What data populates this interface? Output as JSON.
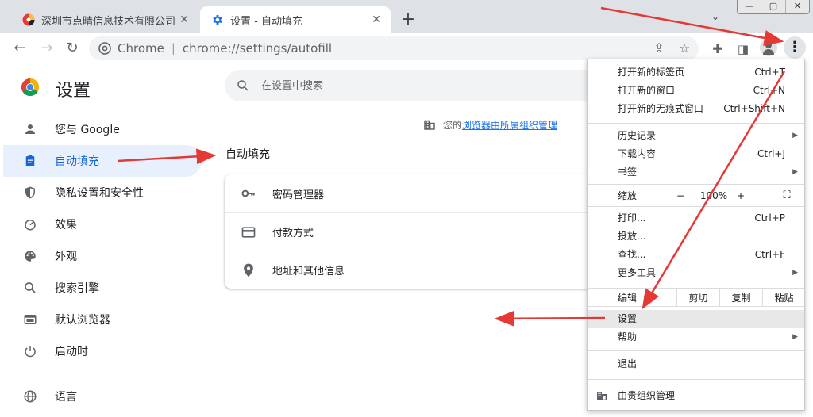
{
  "tabs": [
    {
      "title": "深圳市点晴信息技术有限公司点晴",
      "active": false,
      "favicon": "site-favicon"
    },
    {
      "title": "设置 - 自动填充",
      "active": true,
      "favicon": "gear-icon"
    }
  ],
  "new_tab": "+",
  "window_controls": {
    "minimize": "—",
    "maximize": "▢",
    "close": "✕"
  },
  "address": {
    "scheme": "Chrome",
    "separator": "|",
    "url": "chrome://settings/autofill"
  },
  "settings": {
    "title": "设置",
    "search_placeholder": "在设置中搜索",
    "nav": [
      {
        "label": "您与 Google",
        "icon": "person-icon",
        "active": false
      },
      {
        "label": "自动填充",
        "icon": "clipboard-icon",
        "active": true
      },
      {
        "label": "隐私设置和安全性",
        "icon": "shield-icon",
        "active": false
      },
      {
        "label": "效果",
        "icon": "speedometer-icon",
        "active": false
      },
      {
        "label": "外观",
        "icon": "palette-icon",
        "active": false
      },
      {
        "label": "搜索引擎",
        "icon": "search-icon",
        "active": false
      },
      {
        "label": "默认浏览器",
        "icon": "browser-icon",
        "active": false
      },
      {
        "label": "启动时",
        "icon": "power-icon",
        "active": false
      }
    ],
    "nav_language": {
      "label": "语言",
      "icon": "globe-icon"
    },
    "org_note_prefix": "您的",
    "org_note_link": "浏览器由所属组织管理",
    "section_title": "自动填充",
    "autofill_items": [
      {
        "label": "密码管理器",
        "icon": "key-icon"
      },
      {
        "label": "付款方式",
        "icon": "credit-card-icon"
      },
      {
        "label": "地址和其他信息",
        "icon": "location-pin-icon"
      }
    ]
  },
  "menu": {
    "items": [
      {
        "label": "打开新的标签页",
        "shortcut": "Ctrl+T"
      },
      {
        "label": "打开新的窗口",
        "shortcut": "Ctrl+N"
      },
      {
        "label": "打开新的无痕式窗口",
        "shortcut": "Ctrl+Shift+N"
      },
      {
        "label": "历史记录",
        "shortcut": "",
        "submenu": true
      },
      {
        "label": "下载内容",
        "shortcut": "Ctrl+J"
      },
      {
        "label": "书签",
        "shortcut": "",
        "submenu": true
      },
      {
        "label": "打印...",
        "shortcut": "Ctrl+P"
      },
      {
        "label": "投放...",
        "shortcut": ""
      },
      {
        "label": "查找...",
        "shortcut": "Ctrl+F"
      },
      {
        "label": "更多工具",
        "shortcut": "",
        "submenu": true
      },
      {
        "label": "设置",
        "shortcut": "",
        "highlighted": true
      },
      {
        "label": "帮助",
        "shortcut": "",
        "submenu": true
      },
      {
        "label": "退出",
        "shortcut": ""
      }
    ],
    "zoom": {
      "label": "缩放",
      "minus": "−",
      "value": "100%",
      "plus": "+",
      "fullscreen": "⛶"
    },
    "edit": {
      "label": "编辑",
      "cut": "剪切",
      "copy": "复制",
      "paste": "粘贴"
    },
    "managed": "由贵组织管理"
  },
  "colors": {
    "accent": "#1a73e8",
    "active_nav_bg": "#e8f0fe",
    "arrow": "#e53935"
  }
}
